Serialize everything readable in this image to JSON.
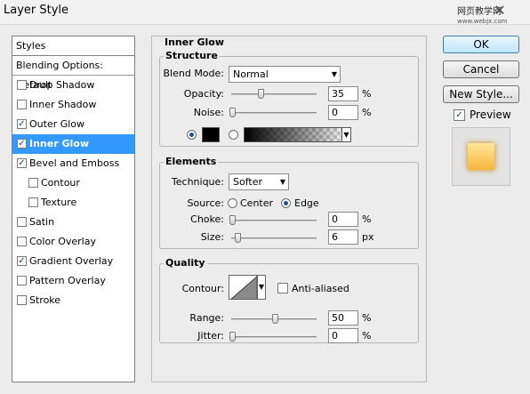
{
  "window": {
    "title": "Layer Style",
    "close_glyph": "✕"
  },
  "watermark": {
    "line1": "网页教学网",
    "line2": "www.webjx.com"
  },
  "styles_panel": {
    "header": "Styles",
    "blending_options": "Blending Options: Default",
    "items": [
      {
        "label": "Drop Shadow",
        "checked": false,
        "indent": false,
        "selected": false
      },
      {
        "label": "Inner Shadow",
        "checked": false,
        "indent": false,
        "selected": false
      },
      {
        "label": "Outer Glow",
        "checked": true,
        "indent": false,
        "selected": false
      },
      {
        "label": "Inner Glow",
        "checked": true,
        "indent": false,
        "selected": true
      },
      {
        "label": "Bevel and Emboss",
        "checked": true,
        "indent": false,
        "selected": false
      },
      {
        "label": "Contour",
        "checked": false,
        "indent": true,
        "selected": false
      },
      {
        "label": "Texture",
        "checked": false,
        "indent": true,
        "selected": false
      },
      {
        "label": "Satin",
        "checked": false,
        "indent": false,
        "selected": false
      },
      {
        "label": "Color Overlay",
        "checked": false,
        "indent": false,
        "selected": false
      },
      {
        "label": "Gradient Overlay",
        "checked": true,
        "indent": false,
        "selected": false
      },
      {
        "label": "Pattern Overlay",
        "checked": false,
        "indent": false,
        "selected": false
      },
      {
        "label": "Stroke",
        "checked": false,
        "indent": false,
        "selected": false
      }
    ],
    "check_glyph": "✓"
  },
  "inner_glow": {
    "title": "Inner Glow",
    "structure": {
      "title": "Structure",
      "blend_mode_label": "Blend Mode:",
      "blend_mode_value": "Normal",
      "opacity_label": "Opacity:",
      "opacity_value": "35",
      "noise_label": "Noise:",
      "noise_value": "0",
      "percent": "%",
      "glow_color": "#000000"
    },
    "elements": {
      "title": "Elements",
      "technique_label": "Technique:",
      "technique_value": "Softer",
      "source_label": "Source:",
      "source_center": "Center",
      "source_edge": "Edge",
      "choke_label": "Choke:",
      "choke_value": "0",
      "size_label": "Size:",
      "size_value": "6",
      "percent": "%",
      "px": "px"
    },
    "quality": {
      "title": "Quality",
      "contour_label": "Contour:",
      "anti_aliased_label": "Anti-aliased",
      "range_label": "Range:",
      "range_value": "50",
      "jitter_label": "Jitter:",
      "jitter_value": "0",
      "percent": "%"
    }
  },
  "buttons": {
    "ok": "OK",
    "cancel": "Cancel",
    "new_style": "New Style...",
    "preview_label": "Preview",
    "preview_checked": true
  },
  "colors": {
    "selection": "#3399ff",
    "preview_fill_top": "#ffe69a",
    "preview_fill_bottom": "#f6b43b"
  }
}
